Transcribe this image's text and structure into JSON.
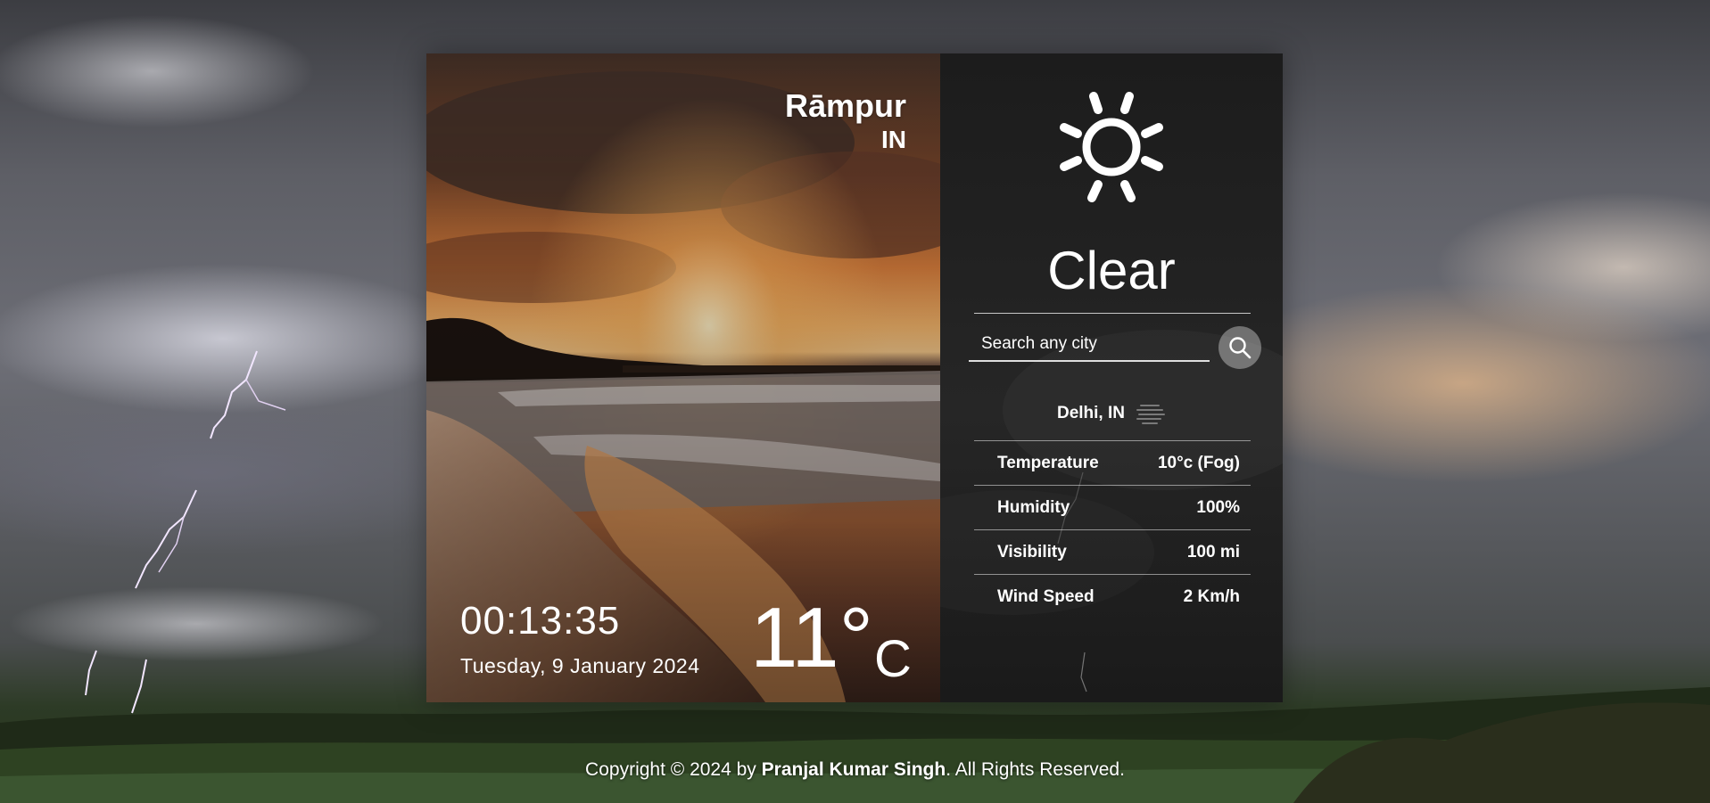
{
  "colors": {
    "panel_dark": "#1f1f1f",
    "search_button": "#7a7a7a",
    "text": "#ffffff"
  },
  "location": {
    "city": "Rāmpur",
    "country": "IN"
  },
  "clock": {
    "time": "00:13:35",
    "date": "Tuesday, 9 January 2024"
  },
  "current": {
    "temperature": "11°",
    "unit": "C",
    "condition": "Clear",
    "condition_icon": "sun-icon"
  },
  "search": {
    "placeholder": "Search any city",
    "value": "",
    "button_icon": "search-icon"
  },
  "result": {
    "location": "Delhi, IN",
    "icon": "fog-icon"
  },
  "details": [
    {
      "label": "Temperature",
      "value": "10°c (Fog)"
    },
    {
      "label": "Humidity",
      "value": "100%"
    },
    {
      "label": "Visibility",
      "value": "100 mi"
    },
    {
      "label": "Wind Speed",
      "value": "2 Km/h"
    }
  ],
  "footer": {
    "prefix": "Copyright © 2024 by ",
    "author": "Pranjal Kumar Singh",
    "suffix": ". All Rights Reserved."
  }
}
